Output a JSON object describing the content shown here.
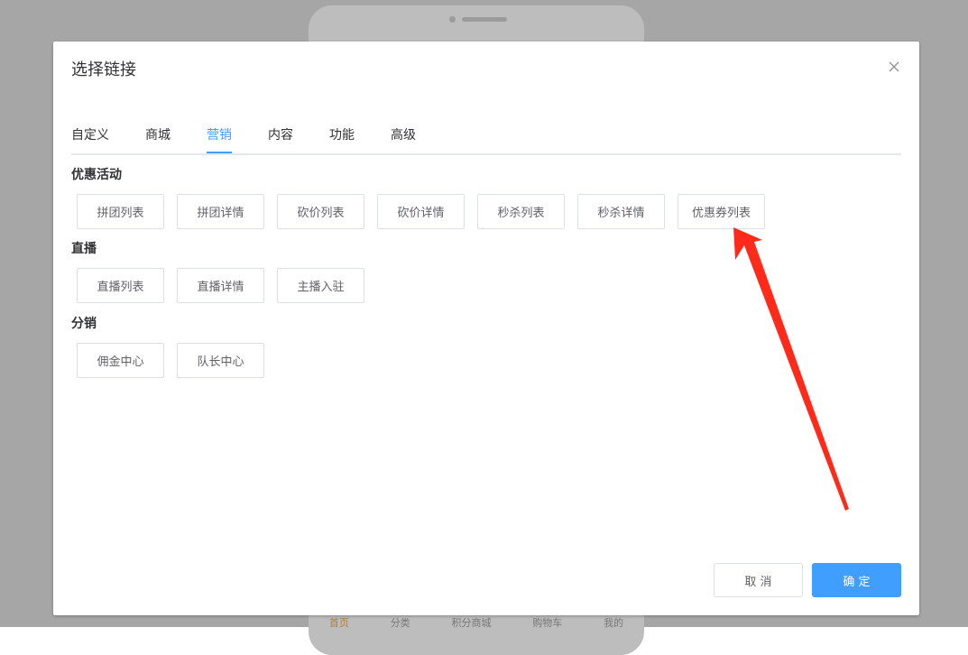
{
  "dialog": {
    "title": "选择链接",
    "close_icon": "close-icon"
  },
  "tabs": [
    {
      "label": "自定义",
      "active": false
    },
    {
      "label": "商城",
      "active": false
    },
    {
      "label": "营销",
      "active": true
    },
    {
      "label": "内容",
      "active": false
    },
    {
      "label": "功能",
      "active": false
    },
    {
      "label": "高级",
      "active": false
    }
  ],
  "sections": [
    {
      "label": "优惠活动",
      "items": [
        "拼团列表",
        "拼团详情",
        "砍价列表",
        "砍价详情",
        "秒杀列表",
        "秒杀详情",
        "优惠券列表"
      ]
    },
    {
      "label": "直播",
      "items": [
        "直播列表",
        "直播详情",
        "主播入驻"
      ]
    },
    {
      "label": "分销",
      "items": [
        "佣金中心",
        "队长中心"
      ]
    }
  ],
  "footer": {
    "cancel_label": "取 消",
    "confirm_label": "确 定"
  },
  "background_phone": {
    "tabbar": [
      "首页",
      "分类",
      "积分商城",
      "购物车",
      "我的"
    ]
  },
  "colors": {
    "accent": "#409eff",
    "annotation_arrow": "#ff2a1a",
    "overlay": "#a6a6a6"
  }
}
